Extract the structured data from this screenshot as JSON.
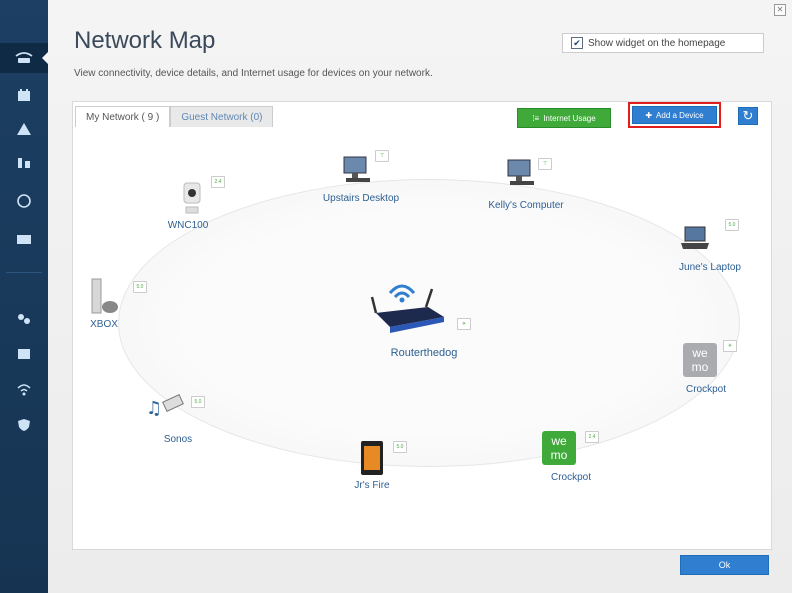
{
  "header": {
    "title": "Network Map",
    "subtitle": "View connectivity, device details, and Internet usage for devices on your network.",
    "widget_label": "Show widget on the homepage",
    "widget_checked": true
  },
  "tabs": [
    {
      "label": "My Network ( 9 )"
    },
    {
      "label": "Guest Network (0)"
    }
  ],
  "toolbar": {
    "usage_label": "Internet Usage",
    "add_label": "Add a Device"
  },
  "router": {
    "label": "Routerthedog"
  },
  "devices": [
    {
      "label": "WNC100",
      "signal": "2.4"
    },
    {
      "label": "Upstairs Desktop"
    },
    {
      "label": "Kelly's Computer"
    },
    {
      "label": "June's Laptop",
      "signal": "5.0"
    },
    {
      "label": "XBOX",
      "signal": "5.0"
    },
    {
      "label": "Crockpot",
      "icon": "wemo"
    },
    {
      "label": "Sonos",
      "signal": "5.0"
    },
    {
      "label": "Jr's Fire",
      "signal": "5.0"
    },
    {
      "label": "Crockpot",
      "icon": "wemo",
      "signal": "2.4"
    }
  ],
  "footer": {
    "ok_label": "Ok"
  },
  "colors": {
    "sidebar": "#1c3f63",
    "accent": "#2f7ed0",
    "usage": "#3faa3a",
    "highlight": "#e21d1d",
    "label": "#2d5f93"
  }
}
